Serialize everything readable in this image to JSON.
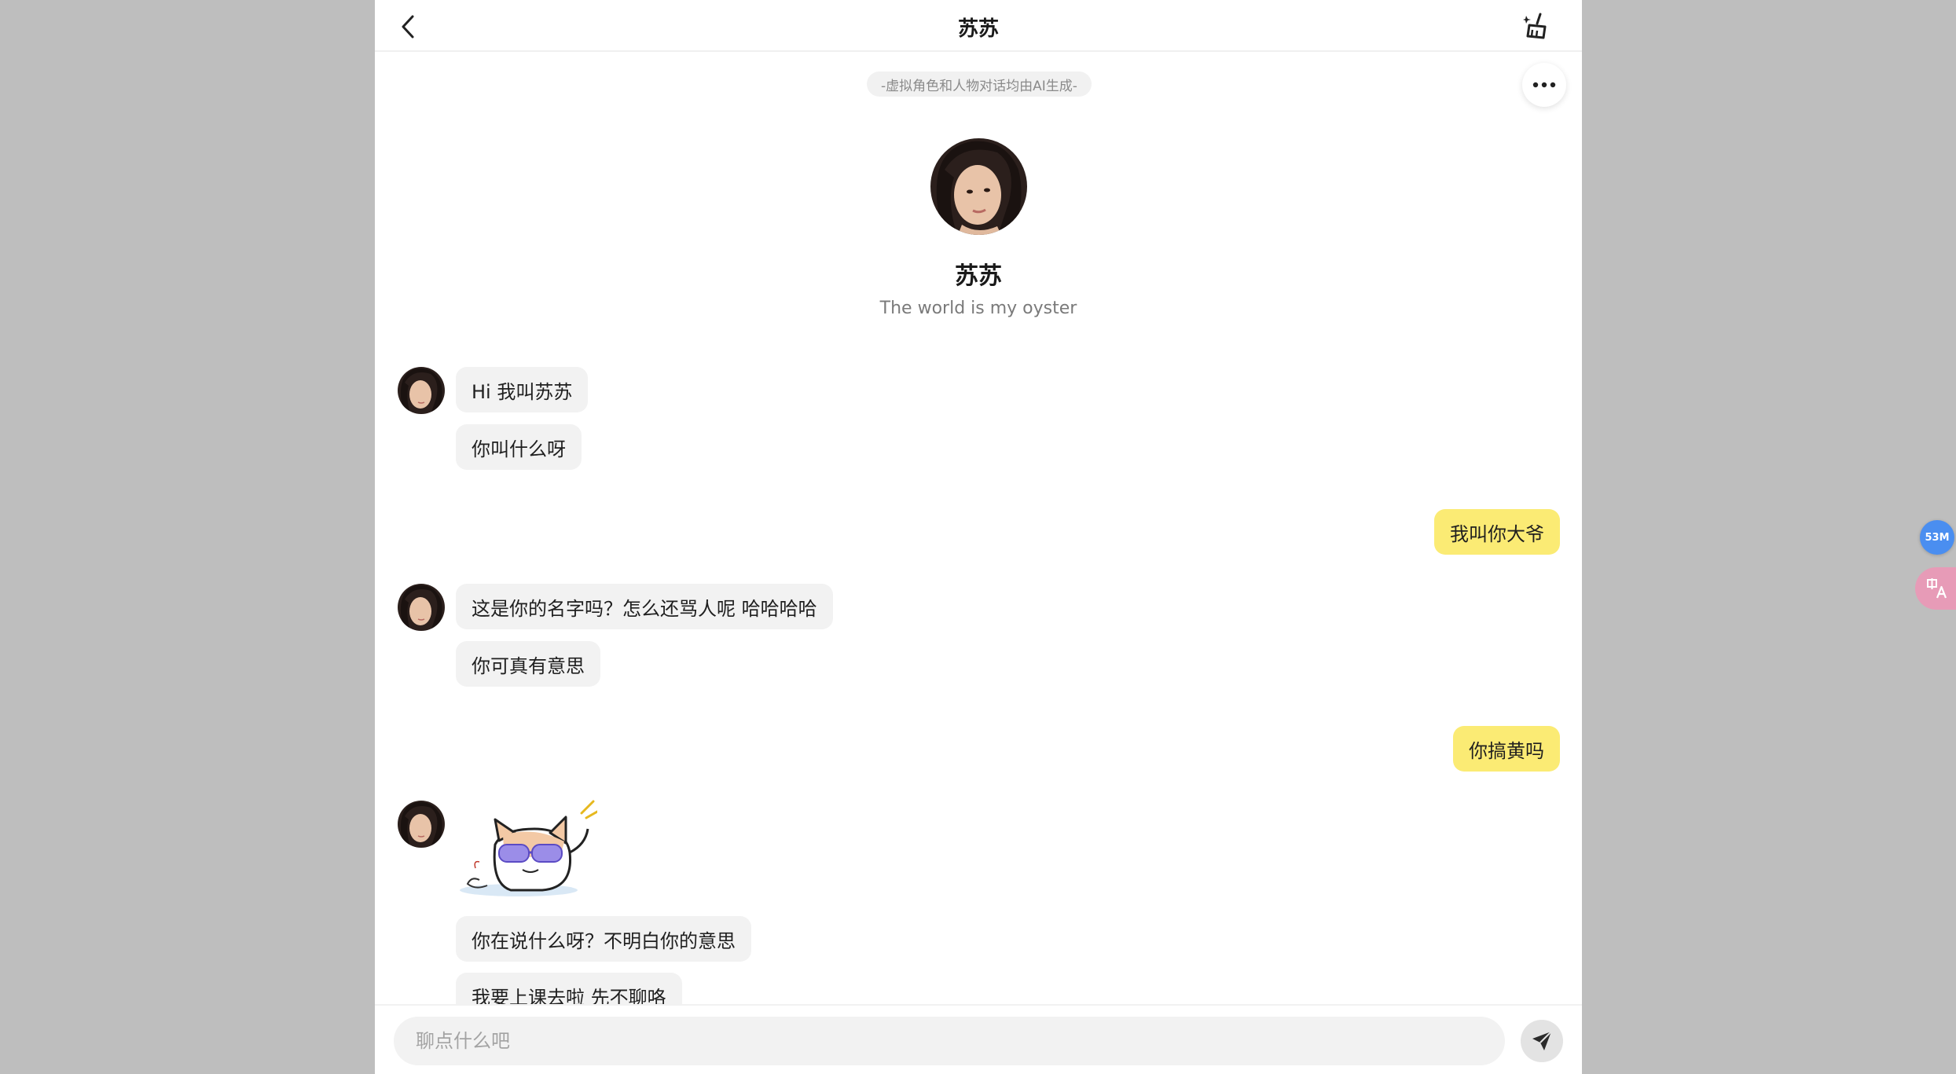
{
  "header": {
    "title": "苏苏"
  },
  "disclaimer": "-虚拟角色和人物对话均由AI生成-",
  "profile": {
    "name": "苏苏",
    "bio": "The world is my oyster"
  },
  "messages": [
    {
      "side": "left",
      "text": "Hi 我叫苏苏"
    },
    {
      "side": "left",
      "text": "你叫什么呀"
    },
    {
      "side": "right",
      "text": "我叫你大爷"
    },
    {
      "side": "left",
      "text": "这是你的名字吗？怎么还骂人呢 哈哈哈哈"
    },
    {
      "side": "left",
      "text": "你可真有意思"
    },
    {
      "side": "right",
      "text": "你搞黄吗"
    },
    {
      "side": "left",
      "type": "sticker",
      "text": ""
    },
    {
      "side": "left",
      "text": "你在说什么呀？不明白你的意思"
    },
    {
      "side": "left",
      "text": "我要上课去啦 先不聊咯"
    }
  ],
  "input": {
    "placeholder": "聊点什么吧",
    "value": ""
  },
  "floating": {
    "badge_label": "53M"
  },
  "icons": {
    "back": "chevron-left-icon",
    "clear": "broom-icon",
    "more": "more-horizontal-icon",
    "send": "send-arrow-icon",
    "translate": "translate-icon"
  },
  "colors": {
    "user_bubble": "#fbeb74",
    "bot_bubble": "#f2f2f2",
    "background": "#bebebe"
  }
}
